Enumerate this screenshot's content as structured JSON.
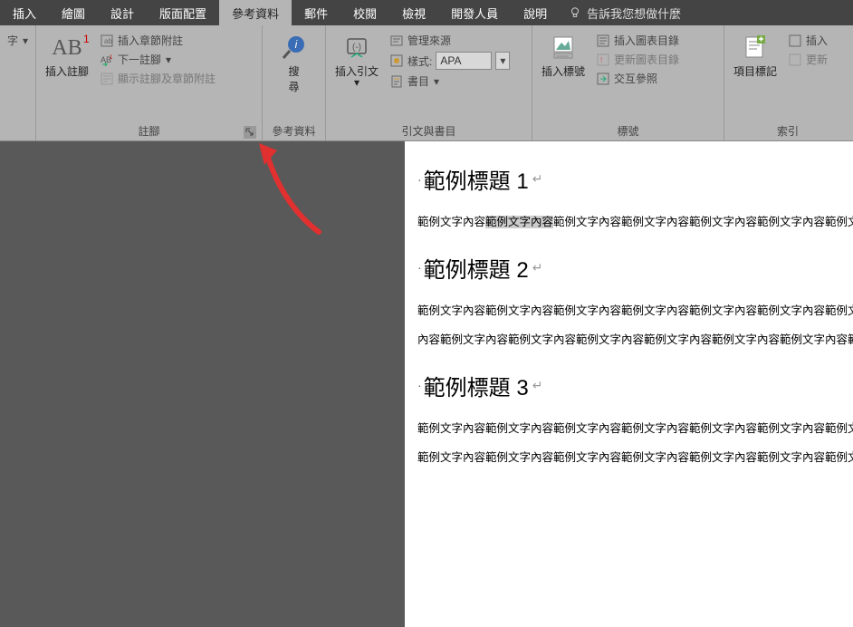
{
  "tabs": {
    "insert": "插入",
    "draw": "繪圖",
    "design": "設計",
    "layout": "版面配置",
    "references": "參考資料",
    "mailings": "郵件",
    "review": "校閱",
    "view": "檢視",
    "developer": "開發人員",
    "help": "說明",
    "tell_me": "告訴我您想做什麼"
  },
  "ribbon": {
    "partial_left": "字",
    "footnotes": {
      "insert_footnote": "插入註腳",
      "insert_endnote": "插入章節附註",
      "next_footnote": "下一註腳",
      "show_notes": "顯示註腳及章節附註",
      "group_label": "註腳"
    },
    "research": {
      "search": "搜\n尋",
      "group_label": "參考資料"
    },
    "citations": {
      "insert_citation": "插入引文",
      "manage_sources": "管理來源",
      "style_label": "樣式:",
      "style_value": "APA",
      "bibliography": "書目",
      "group_label": "引文與書目"
    },
    "captions": {
      "insert_caption": "插入標號",
      "insert_tof": "插入圖表目錄",
      "update_tof": "更新圖表目錄",
      "cross_ref": "交互參照",
      "group_label": "標號"
    },
    "index": {
      "mark_entry": "項目標記",
      "insert_index": "插入",
      "update_index": "更新",
      "group_label": "索引"
    }
  },
  "document": {
    "h1": "範例標題 1",
    "p1a": "範例文字內容",
    "p1_highlight": "範例文字內容",
    "p1b": "範例文字內容範例文字內容範例文字內容範例文字內容範例文字",
    "h2": "範例標題 2",
    "p2a": "範例文字內容範例文字內容範例文字內容範例文字內容範例文字內容範例文字內容範例文字",
    "p2b": "內容範例文字內容範例文字內容範例文字內容範例文字內容範例文字內容範例文字內容範例",
    "h3": "範例標題 3",
    "p3a": "範例文字內容範例文字內容範例文字內容範例文字內容範例文字內容範例文字內容範例文字",
    "p3b": "範例文字內容範例文字內容範例文字內容範例文字內容範例文字內容範例文字內容範例文字"
  }
}
